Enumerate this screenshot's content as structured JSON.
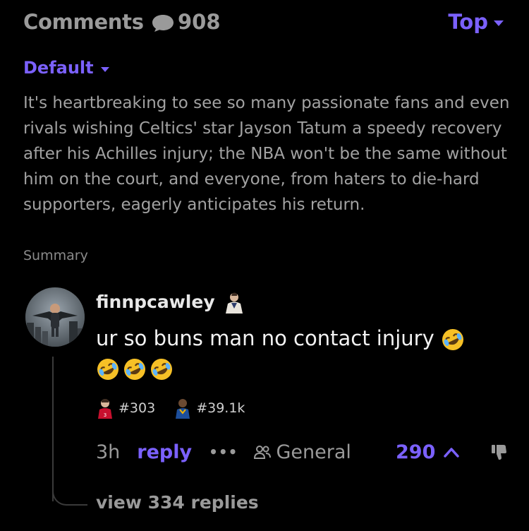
{
  "header": {
    "title": "Comments",
    "count": "908",
    "sort_label": "Top",
    "icons": {
      "count": "speech-bubble-icon",
      "sort": "chevron-down-icon"
    }
  },
  "summary": {
    "filter_label": "Default",
    "text": "It's heartbreaking to see so many passionate fans and even rivals wishing Celtics' star Jayson Tatum a speedy recovery after his Achilles injury; the NBA won't be the same without him on the court, and everyone, from haters to die-hard supporters, eagerly anticipates his return.",
    "label": "Summary"
  },
  "comment": {
    "username": "finnpcawley",
    "body": "ur so buns man no contact injury",
    "emoji": "rolling-on-floor-laughing",
    "emoji_count": 4,
    "badges": [
      {
        "label": "#303",
        "icon": "player-badge-red-icon"
      },
      {
        "label": "#39.1k",
        "icon": "player-badge-blue-icon"
      }
    ],
    "time": "3h",
    "reply_label": "reply",
    "more_label": "•••",
    "channel": "General",
    "votes": "290",
    "view_replies": "view 334 replies"
  },
  "colors": {
    "background": "#000000",
    "accent": "#7b61ff",
    "muted": "#9a9a9a",
    "body_text": "#f2f2f2"
  }
}
